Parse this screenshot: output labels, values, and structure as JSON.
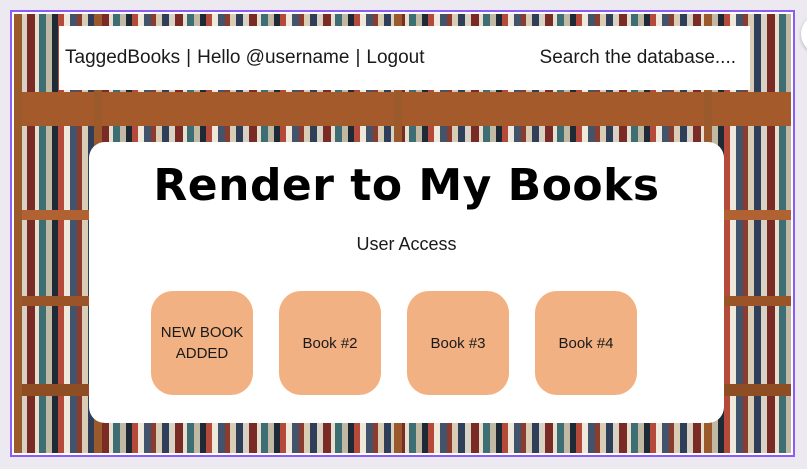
{
  "nav": {
    "brand": "TaggedBooks",
    "separator": "|",
    "greeting": "Hello @username",
    "logout": "Logout",
    "search_placeholder": "Search the database...."
  },
  "main": {
    "title": "Render to My Books",
    "subtitle": "User Access",
    "books": [
      {
        "label": "NEW BOOK ADDED"
      },
      {
        "label": "Book #2"
      },
      {
        "label": "Book #3"
      },
      {
        "label": "Book #4"
      }
    ]
  },
  "colors": {
    "frame": "#8b5cf6",
    "tile": "#f2b182",
    "card": "#ffffff"
  }
}
